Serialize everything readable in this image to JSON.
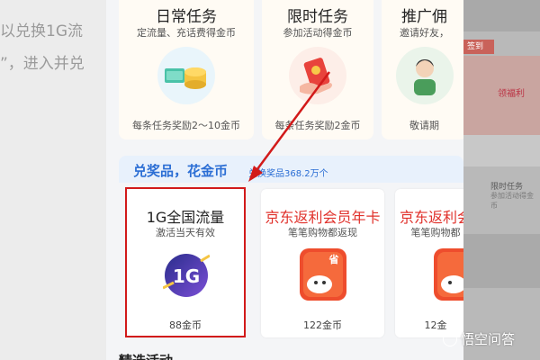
{
  "background": {
    "left_lines": [
      "以兑换1G流",
      "”，进入并兑"
    ],
    "right_labels": [
      "签到",
      "限时任务",
      "参加活动得金币",
      "领福利"
    ]
  },
  "tasks": [
    {
      "title": "日常任务",
      "subtitle": "定流量、充话费得金币",
      "footer": "每条任务奖励2～10金币"
    },
    {
      "title": "限时任务",
      "subtitle": "参加活动得金币",
      "footer": "每条任务奖励2金币"
    },
    {
      "title": "推广佣",
      "subtitle": "邀请好友，",
      "footer": "敬请期"
    }
  ],
  "exchange": {
    "title": "兑奖品，花金币",
    "count": "兑换奖品368.2万个"
  },
  "products": [
    {
      "title": "1G全国流量",
      "subtitle": "激活当天有效",
      "price": "88金币",
      "icon_text": "1G",
      "title_color": "#222222"
    },
    {
      "title": "京东返利会员年卡",
      "subtitle": "笔笔购物都返现",
      "price": "122金币",
      "icon_text": "省",
      "title_color": "#e0312b"
    },
    {
      "title": "京东返利会",
      "subtitle": "笔笔购物都",
      "price": "12金",
      "icon_text": "",
      "title_color": "#e0312b"
    }
  ],
  "featured": {
    "title": "精选活动"
  },
  "watermark": {
    "text": "悟空问答"
  },
  "colors": {
    "accent_blue": "#2b6ed4",
    "highlight_red": "#d21a1a",
    "brand_red": "#e0312b"
  }
}
